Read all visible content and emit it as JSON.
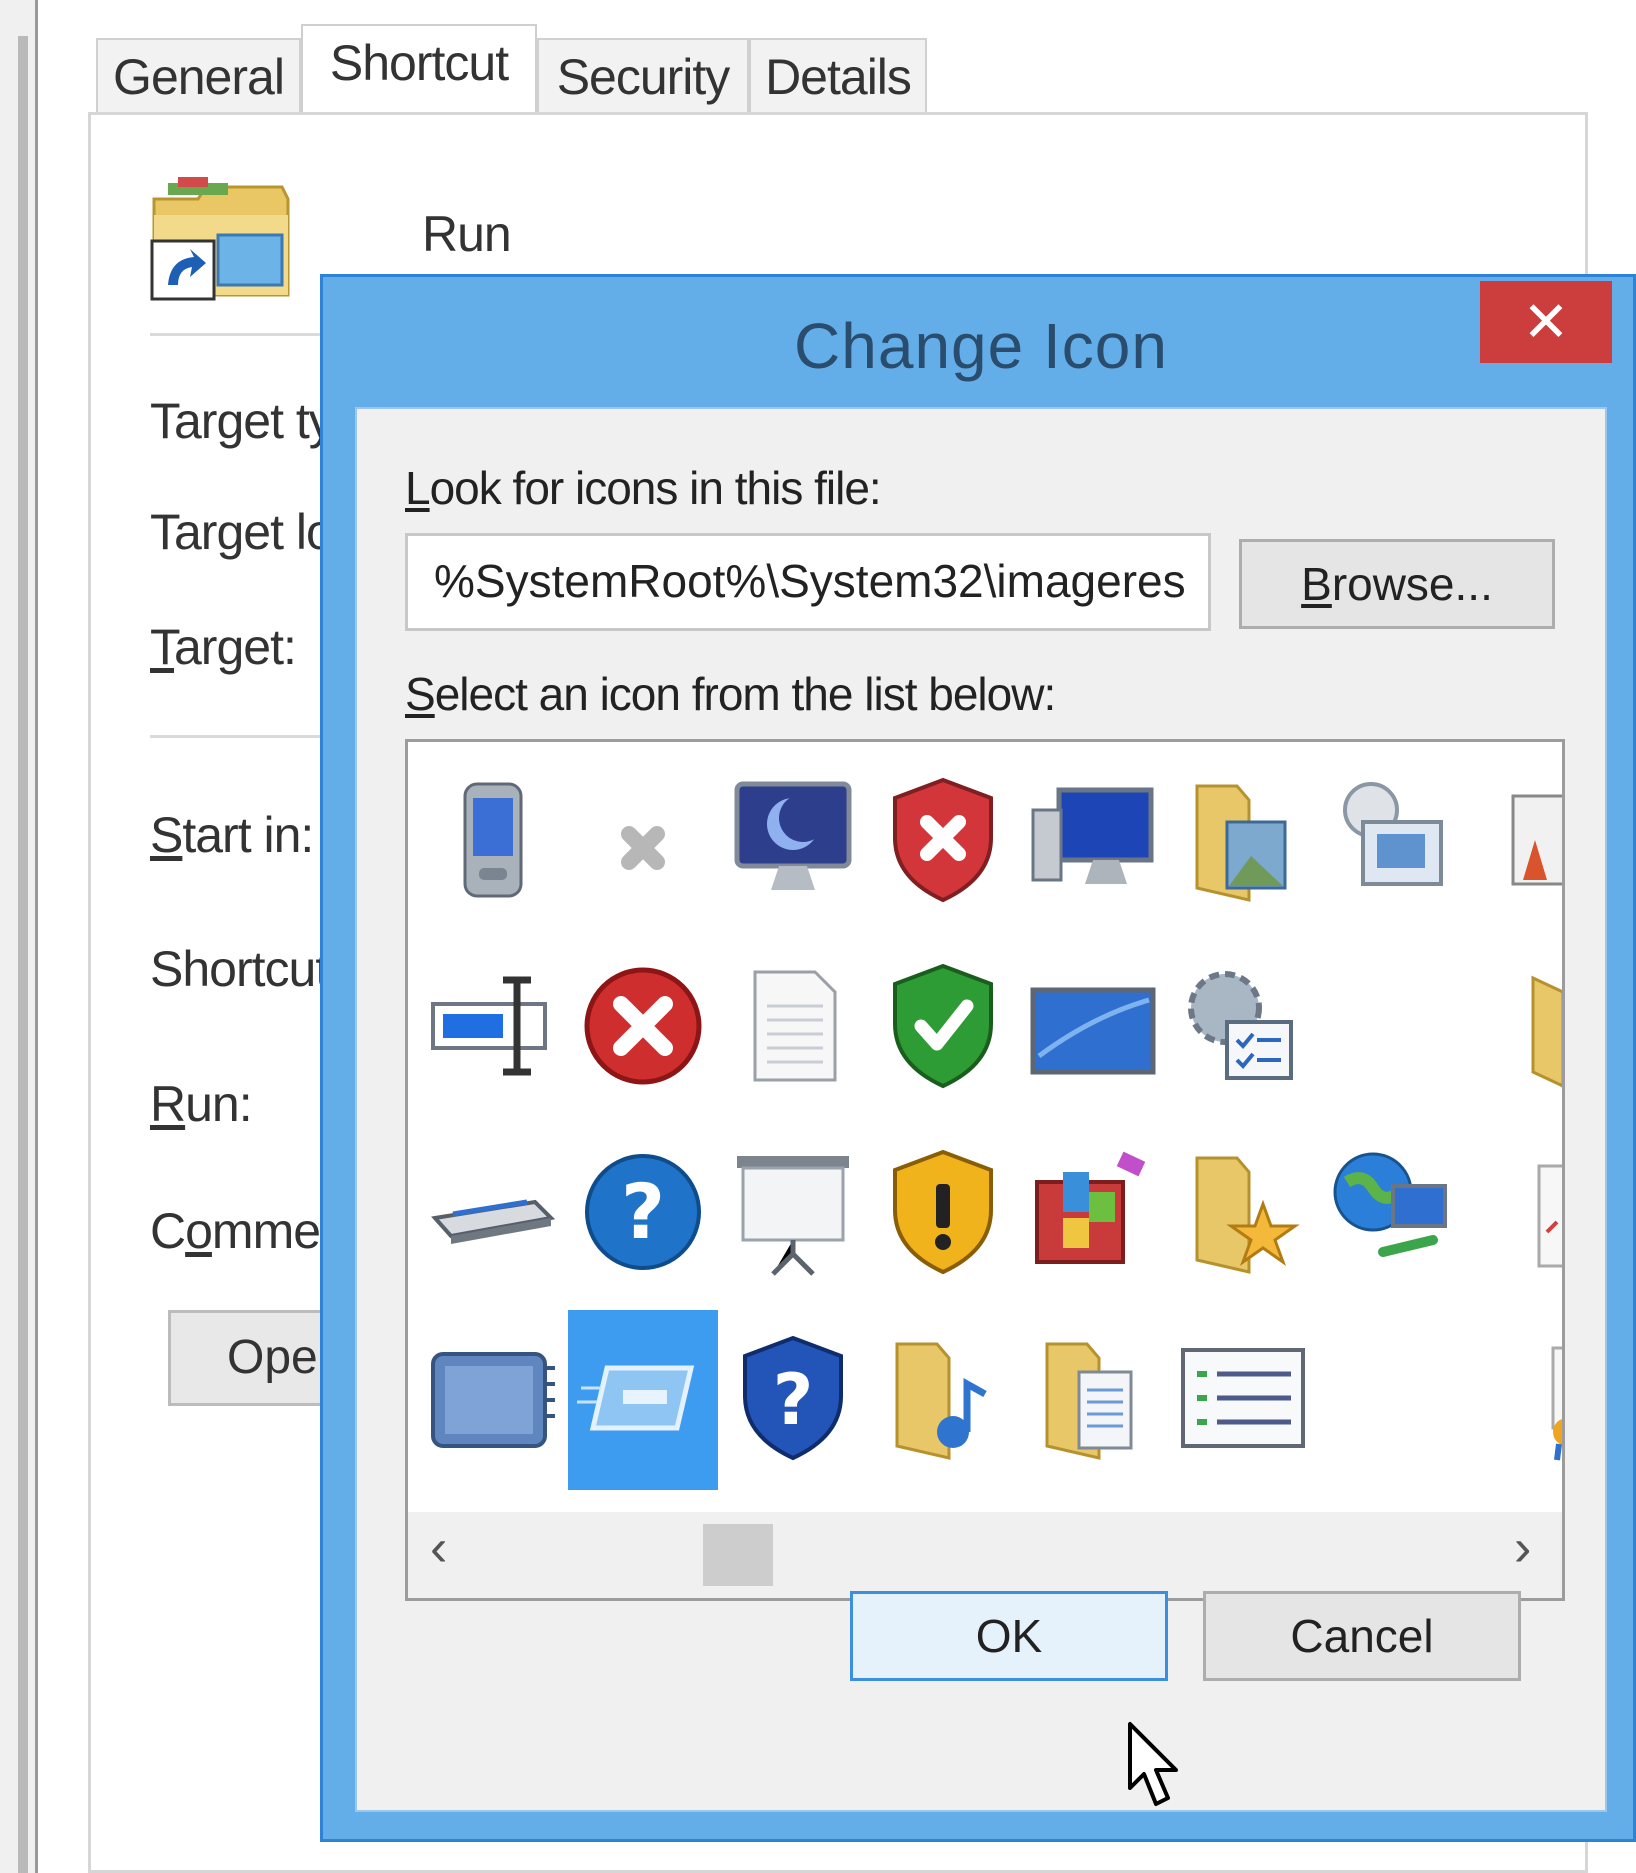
{
  "properties_window": {
    "tabs": [
      {
        "label": "General",
        "active": false
      },
      {
        "label": "Shortcut",
        "active": true
      },
      {
        "label": "Security",
        "active": false
      },
      {
        "label": "Details",
        "active": false
      }
    ],
    "shortcut_name": "Run",
    "fields": {
      "target_type_label": "Target ty",
      "target_location_label": "Target lo",
      "target_label_prefix": "T",
      "target_label_rest": "arget:",
      "start_in_label_prefix": "S",
      "start_in_label_rest": "tart in:",
      "shortcut_key_label": "Shortcut",
      "run_label_prefix": "R",
      "run_label_rest": "un:",
      "comment_label_a": "C",
      "comment_label_u": "o",
      "comment_label_rest": "mmen"
    },
    "open_button_label": "Oper"
  },
  "dialog": {
    "title": "Change Icon",
    "close_label": "✕",
    "look_label_prefix": "L",
    "look_label_rest": "ook for icons in this file:",
    "file_path": "%SystemRoot%\\System32\\imageres",
    "browse_prefix": "B",
    "browse_rest": "rowse...",
    "select_label_prefix": "S",
    "select_label_rest": "elect an icon from the list below:",
    "scroll_left": "‹",
    "scroll_right": "›",
    "ok_label": "OK",
    "cancel_label": "Cancel"
  },
  "icons": [
    [
      "pda-icon",
      "grey-x-icon",
      "monitor-moon-icon",
      "shield-error-icon",
      "computer-network-icon",
      "folder-pictures-icon",
      "control-panel-icon",
      "picture-partial-icon"
    ],
    [
      "rename-textbox-icon",
      "red-error-icon",
      "document-icon",
      "shield-check-icon",
      "laptop-screen-icon",
      "gear-checklist-icon",
      "empty-icon",
      "folder-partial-icon"
    ],
    [
      "scanner-icon",
      "help-question-icon",
      "projector-screen-icon",
      "shield-warning-icon",
      "programs-box-icon",
      "folder-favorites-icon",
      "globe-network-icon",
      "document-partial-icon"
    ],
    [
      "memory-card-icon",
      "minimize-window-icon",
      "shield-help-icon",
      "folder-music-icon",
      "folder-documents-icon",
      "list-view-icon",
      "empty-icon",
      "certificate-partial-icon"
    ]
  ],
  "selected_icon": "minimize-window-icon",
  "colors": {
    "dialog_frame": "#63aee9",
    "close_button": "#cc3d3d",
    "selection": "#3d9cf0",
    "title_text": "#2a4c6d"
  }
}
